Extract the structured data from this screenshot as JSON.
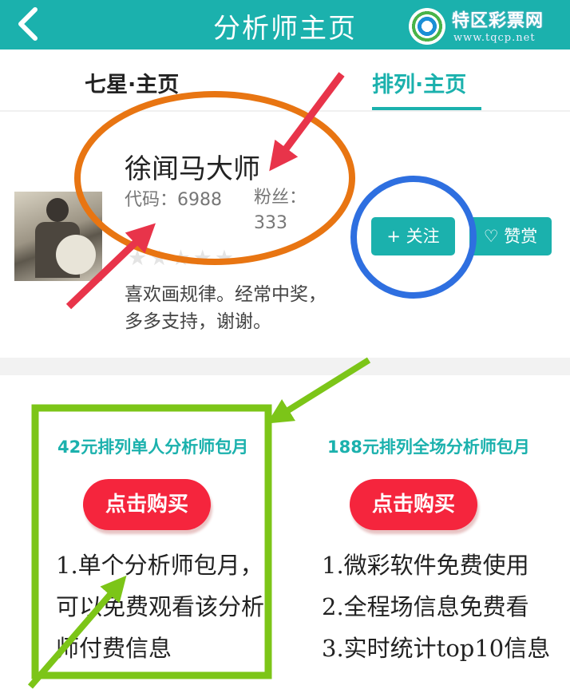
{
  "header": {
    "back_icon": "chevron-left-icon",
    "title": "分析师主页"
  },
  "logo": {
    "name": "特区彩票网",
    "url": "www.tqcp.net"
  },
  "tabs": [
    {
      "label": "七星·主页",
      "active": false
    },
    {
      "label": "排列·主页",
      "active": true
    }
  ],
  "profile": {
    "name": "徐闻马大师",
    "code": "代码：6988",
    "fans": "粉丝：333",
    "stars": "★★★★★",
    "bio": "喜欢画规律。经常中奖，多多支持，谢谢。",
    "follow_label": "+ 关注",
    "reward_label": "♡ 赞赏"
  },
  "plans": [
    {
      "title": "42元排列单人分析师包月",
      "buy_label": "点击购买",
      "features": [
        "1.单个分析师包月，可以免费观看该分析师付费信息"
      ]
    },
    {
      "title": "188元排列全场分析师包月",
      "buy_label": "点击购买",
      "features": [
        "1.微彩软件免费使用",
        "2.全程场信息免费看",
        "3.实时统计top10信息"
      ]
    }
  ],
  "colors": {
    "primary": "#1bb1ad",
    "buy": "#f5253d",
    "ann_orange": "#e87512",
    "ann_blue": "#2e6fe0",
    "ann_green": "#7cc518",
    "ann_red": "#e8344a"
  }
}
